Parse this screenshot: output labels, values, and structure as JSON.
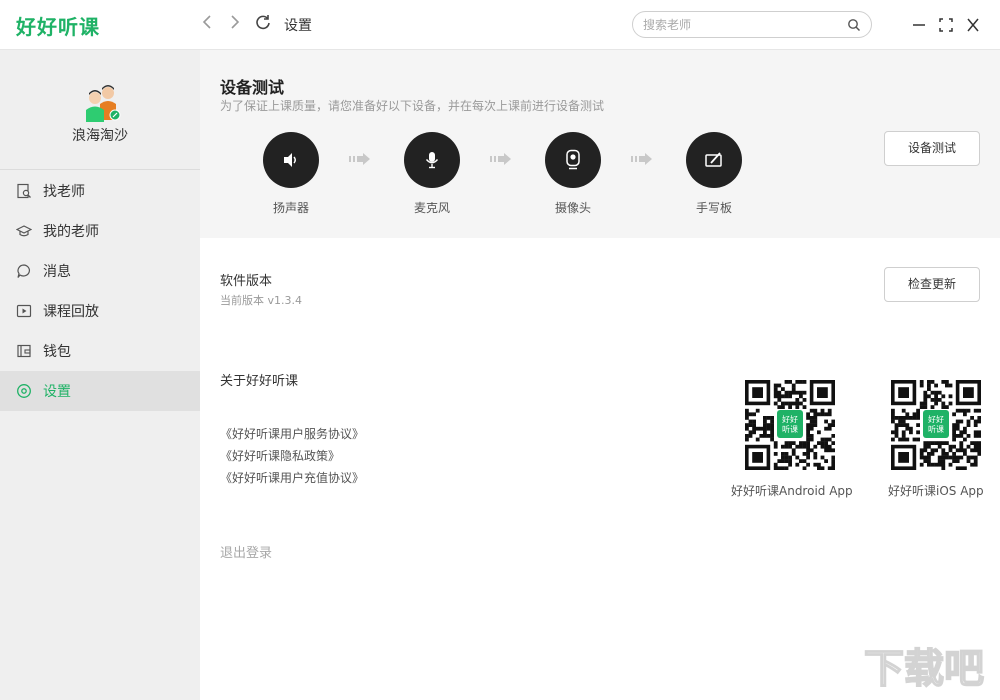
{
  "app": {
    "logo": "好好听课"
  },
  "header": {
    "title": "设置",
    "search_placeholder": "搜索老师"
  },
  "sidebar": {
    "username": "浪海淘沙",
    "items": [
      {
        "label": "找老师",
        "icon": "find-teacher-icon"
      },
      {
        "label": "我的老师",
        "icon": "graduation-cap-icon"
      },
      {
        "label": "消息",
        "icon": "chat-bubble-icon"
      },
      {
        "label": "课程回放",
        "icon": "play-icon"
      },
      {
        "label": "钱包",
        "icon": "wallet-icon"
      },
      {
        "label": "设置",
        "icon": "settings-icon",
        "active": true
      }
    ]
  },
  "device_test": {
    "title": "设备测试",
    "subtitle": "为了保证上课质量，请您准备好以下设备，并在每次上课前进行设备测试",
    "devices": [
      {
        "label": "扬声器",
        "icon": "speaker-icon"
      },
      {
        "label": "麦克风",
        "icon": "microphone-icon"
      },
      {
        "label": "摄像头",
        "icon": "camera-icon"
      },
      {
        "label": "手写板",
        "icon": "tablet-pen-icon"
      }
    ],
    "button": "设备测试"
  },
  "version": {
    "title": "软件版本",
    "current": "当前版本 v1.3.4",
    "button": "检查更新"
  },
  "about": {
    "title": "关于好好听课",
    "links": [
      "《好好听课用户服务协议》",
      "《好好听课隐私政策》",
      "《好好听课用户充值协议》"
    ],
    "qr_codes": [
      {
        "label": "好好听课Android App",
        "badge": "好好听课"
      },
      {
        "label": "好好听课iOS App",
        "badge": "好好听课"
      }
    ]
  },
  "logout": "退出登录",
  "colors": {
    "accent": "#1fb266",
    "sidebar_bg": "#efefef",
    "device_bg": "#f5f5f5",
    "icon_circle": "#222222"
  },
  "watermark": "下载吧"
}
